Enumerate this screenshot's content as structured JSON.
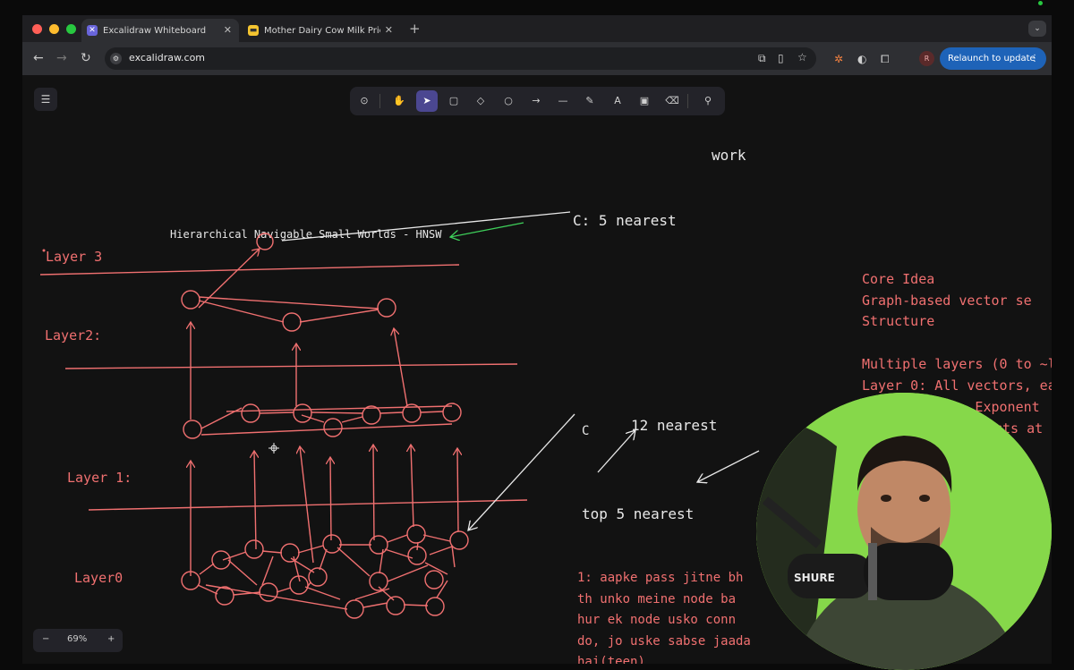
{
  "browser": {
    "tabs": [
      {
        "title": "Excalidraw Whiteboard",
        "active": true
      },
      {
        "title": "Mother Dairy Cow Milk Price",
        "active": false
      }
    ],
    "new_tab_label": "+",
    "url": "excalidraw.com",
    "relaunch_label": "Relaunch to update",
    "profile_initial": "R"
  },
  "zoom": {
    "minus": "−",
    "level": "69%",
    "plus": "+"
  },
  "canvas_text": {
    "work": "work",
    "hnsw_title": "Hierarchical Navigable Small Worlds - HNSW",
    "c5_nearest": "C: 5 nearest",
    "layer3": "Layer 3",
    "layer2": "Layer2:",
    "layer1": "Layer 1:",
    "layer0": "Layer0",
    "c_label": "C",
    "nearest12": "12 nearest",
    "top5": "top 5 nearest",
    "core_lines": [
      "Core Idea",
      "Graph-based vector se",
      "Structure",
      "",
      "Multiple layers (0 to ~l",
      "Layer 0: All vectors, ea",
      "Upper layers: Exponent",
      "cts at"
    ],
    "note_lines": [
      "1: aapke pass jitne bh",
      "th unko meine node ba",
      "hur ek node usko conn",
      "do, jo uske sabse jaada",
      "hai(teen)"
    ],
    "mic_brand": "SHURE"
  },
  "colors": {
    "sketch": "#f07070",
    "white": "#e8e8e8",
    "green": "#3ecf5a",
    "accent": "#4b4791"
  },
  "icons": [
    "lock-icon",
    "hand-icon",
    "pointer-icon",
    "rectangle-icon",
    "diamond-icon",
    "ellipse-icon",
    "arrow-icon",
    "line-icon",
    "pencil-icon",
    "text-icon",
    "image-icon",
    "eraser-icon",
    "more-tools-icon"
  ]
}
